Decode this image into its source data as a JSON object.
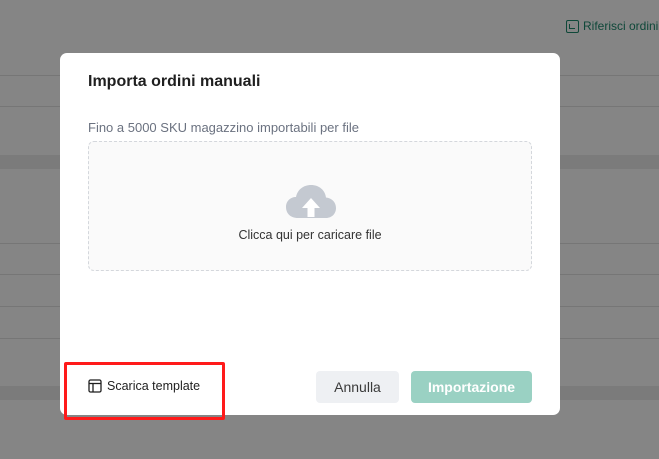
{
  "background": {
    "link_label": "Riferisci ordini"
  },
  "modal": {
    "title": "Importa ordini manuali",
    "hint": "Fino a 5000 SKU magazzino importabili per file",
    "dropzone_text": "Clicca qui per caricare file",
    "download_label": "Scarica template",
    "cancel_label": "Annulla",
    "import_label": "Importazione"
  },
  "colors": {
    "accent": "#1e8a6e",
    "import_disabled": "#9ad1c3",
    "highlight": "#ff1a1a"
  }
}
